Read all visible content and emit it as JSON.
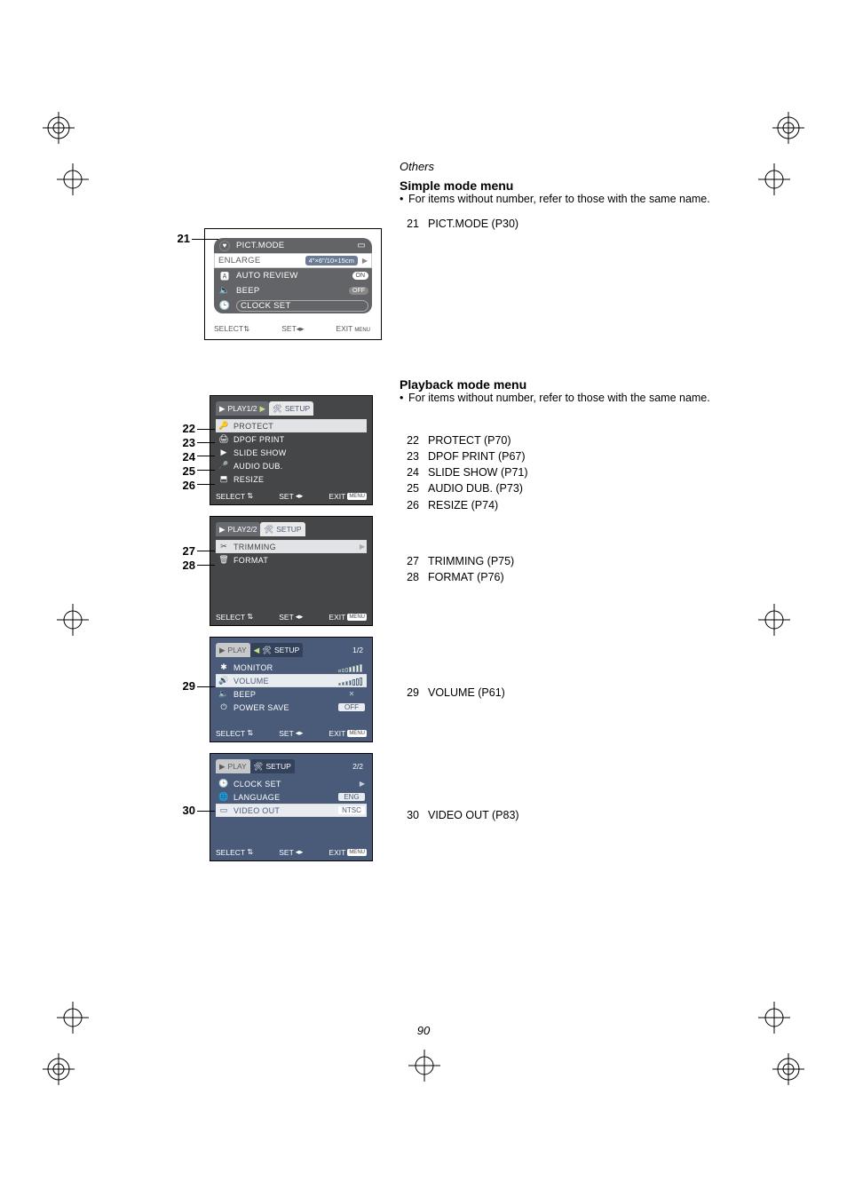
{
  "page": {
    "section": "Others",
    "number": "90"
  },
  "simple": {
    "heading": "Simple mode menu",
    "note": "For items without number, refer to those with the same name.",
    "ref": {
      "num": "21",
      "text": "PICT.MODE (P30)"
    },
    "callout": "21",
    "panel": {
      "pict": "PICT.MODE",
      "enlarge_label": "ENLARGE",
      "enlarge_val": "4\"×6\"/10×15cm",
      "autoreview": "AUTO REVIEW",
      "autoreview_val": "ON",
      "beep": "BEEP",
      "beep_val": "OFF",
      "clock": "CLOCK SET",
      "footer_select": "SELECT",
      "footer_set": "SET",
      "footer_exit": "EXIT",
      "footer_menu": "MENU"
    }
  },
  "playback": {
    "heading": "Playback mode menu",
    "note": "For items without number, refer to those with the same name.",
    "panel1": {
      "tab_play": "PLAY1/2",
      "tab_setup": "SETUP",
      "rows": {
        "protect": "PROTECT",
        "dpof": "DPOF PRINT",
        "slide": "SLIDE SHOW",
        "audio": "AUDIO DUB.",
        "resize": "RESIZE"
      }
    },
    "panel2": {
      "tab_play": "PLAY2/2",
      "tab_setup": "SETUP",
      "rows": {
        "trimming": "TRIMMING",
        "format": "FORMAT"
      }
    },
    "panel3": {
      "tab_play": "PLAY",
      "tab_setup": "SETUP",
      "page": "1/2",
      "rows": {
        "monitor": "MONITOR",
        "volume": "VOLUME",
        "beep": "BEEP",
        "power": "POWER SAVE",
        "power_val": "OFF"
      }
    },
    "panel4": {
      "tab_play": "PLAY",
      "tab_setup": "SETUP",
      "page": "2/2",
      "rows": {
        "clock": "CLOCK SET",
        "language": "LANGUAGE",
        "language_val": "ENG",
        "video": "VIDEO OUT",
        "video_val": "NTSC"
      }
    },
    "footer": {
      "select": "SELECT",
      "set": "SET",
      "exit": "EXIT",
      "menu": "MENU"
    },
    "refs1": [
      {
        "num": "22",
        "text": "PROTECT (P70)"
      },
      {
        "num": "23",
        "text": "DPOF PRINT (P67)"
      },
      {
        "num": "24",
        "text": "SLIDE SHOW (P71)"
      },
      {
        "num": "25",
        "text": "AUDIO DUB. (P73)"
      },
      {
        "num": "26",
        "text": "RESIZE (P74)"
      }
    ],
    "refs2": [
      {
        "num": "27",
        "text": "TRIMMING (P75)"
      },
      {
        "num": "28",
        "text": "FORMAT (P76)"
      }
    ],
    "ref3": {
      "num": "29",
      "text": "VOLUME (P61)"
    },
    "ref4": {
      "num": "30",
      "text": "VIDEO OUT (P83)"
    },
    "callouts": {
      "c22": "22",
      "c23": "23",
      "c24": "24",
      "c25": "25",
      "c26": "26",
      "c27": "27",
      "c28": "28",
      "c29": "29",
      "c30": "30"
    }
  }
}
